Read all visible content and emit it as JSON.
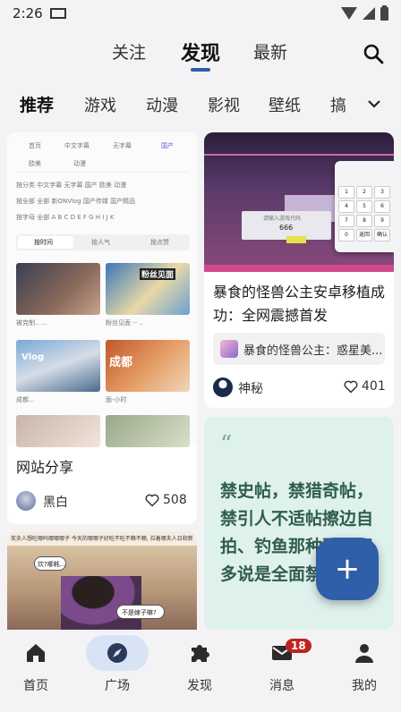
{
  "status": {
    "time": "2:26"
  },
  "top_tabs": [
    {
      "label": "关注"
    },
    {
      "label": "发现"
    },
    {
      "label": "最新"
    }
  ],
  "categories": [
    {
      "label": "推荐"
    },
    {
      "label": "游戏"
    },
    {
      "label": "动漫"
    },
    {
      "label": "影视"
    },
    {
      "label": "壁纸"
    },
    {
      "label": "搞"
    }
  ],
  "card1": {
    "mini_tabs": [
      "首页",
      "中文字幕",
      "无字幕",
      "国产",
      "欧美",
      "动漫"
    ],
    "filter_rows": [
      "按分类  中文字幕  无字幕  国产  欧美  动漫",
      "按全部  全部  新ONVlog  国产传媒  国产精品",
      "按字母  全部  A  B  C  D  E  F  G  H  I  J  K"
    ],
    "sort_tabs": [
      "按时间",
      "按人气",
      "按点赞"
    ],
    "thumb_captions": [
      "被克制..  ...",
      "粉丝见面 -- ..",
      "成都...",
      "面-小时"
    ],
    "thumb_labels": [
      "粉丝见面",
      "成都",
      "Vlog"
    ],
    "title": "网站分享",
    "author": "黑白",
    "likes": "508"
  },
  "card2": {
    "title": "暴食的怪兽公主安卓移植成功：全网震撼首发",
    "link_text": "暴食的怪兽公主：惑星美...",
    "author": "神秘",
    "likes": "401",
    "screen_text": "请输入游戏代码",
    "screen_code": "666",
    "keypad": [
      "1",
      "2",
      "3",
      "4",
      "5",
      "6",
      "7",
      "8",
      "9",
      "0",
      "返回",
      "确认"
    ]
  },
  "card3": {
    "quote": "“",
    "text": "禁史帖，禁猎奇帖，禁引人不适帖擦边自拍、钓鱼那种更不用多说是全面禁止。"
  },
  "card4": {
    "header_text": "炭夫人想吃哪吗哪哪哪子 今天的哪哪子好吃不吃不赖不赖, 拉着哪夫人日和新歌",
    "bubble1": "炊?哪耗...",
    "bubble2": "不是嫁子嘛?"
  },
  "fab": {
    "label": "+"
  },
  "bottom_nav": [
    {
      "label": "首页",
      "icon": "home-icon"
    },
    {
      "label": "广场",
      "icon": "compass-icon"
    },
    {
      "label": "发现",
      "icon": "puzzle-icon"
    },
    {
      "label": "消息",
      "icon": "mail-icon",
      "badge": "18"
    },
    {
      "label": "我的",
      "icon": "person-icon"
    }
  ],
  "colors": {
    "accent": "#2e5fa8",
    "active_pill": "#d8e4f6",
    "badge": "#c0231f",
    "card3_bg": "#dff1ec",
    "card3_text": "#2f5d4f"
  }
}
